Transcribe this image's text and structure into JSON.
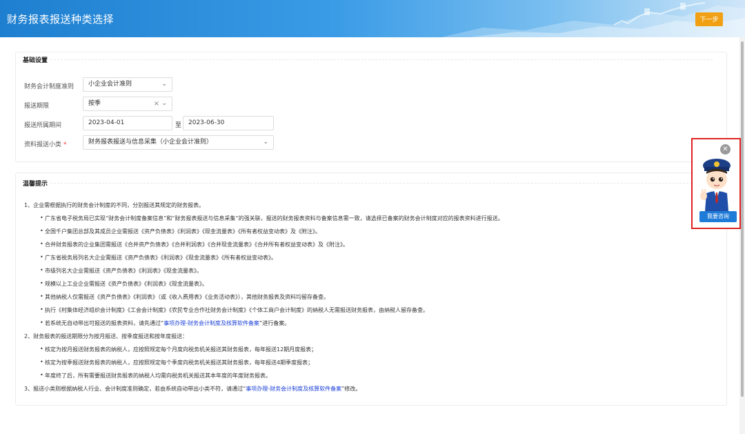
{
  "header": {
    "title": "财务报表报送种类选择",
    "next_label": "下一步"
  },
  "basic": {
    "section_title": "基础设置",
    "accounting_standard_label": "财务会计制度准则",
    "accounting_standard_value": "小企业会计准则",
    "period_label": "报送期限",
    "period_value": "按季",
    "date_label": "报送所属期间",
    "date_start": "2023-04-01",
    "date_sep": "至",
    "date_end": "2023-06-30",
    "subclass_label": "资料报送小类",
    "required_mark": "*",
    "subclass_value": "财务报表报送与信息采集（小企业会计准则）"
  },
  "tips": {
    "section_title": "温馨提示",
    "p1": "1、企业需根据执行的财务会计制度的不同，分别报送其规定的财务报表。",
    "b1": "广东省电子税务局已实现“财务会计制度备案信息”和“财务报表报送与信息采集”的强关联，报送的财务报表资料与备案信息需一致，请选择已备案的财务会计制度对应的报表资料进行报送。",
    "b2": "全国千户集团总部及其成员企业需报送《资产负债表》《利润表》《现金流量表》《所有者权益变动表》及《附注》。",
    "b3": "合并财务报表的企业集团需报送《合并资产负债表》《合并利润表》《合并现金流量表》《合并所有者权益变动表》及《附注》。",
    "b4": "广东省税务局列名大企业需报送《资产负债表》《利润表》《现金流量表》《所有者权益变动表》。",
    "b5": "市级列名大企业需报送《资产负债表》《利润表》《现金流量表》。",
    "b6": "规模以上工业企业需报送《资产负债表》《利润表》《现金流量表》。",
    "b7": "其他纳税人仅需报送《资产负债表》《利润表》（或《收入费用表》《业务活动表》），其他财务报表及资料均留存备查。",
    "b8": "执行《村集体经济组织会计制度》《工会会计制度》《农民专业合作社财务会计制度》《个体工商户会计制度》的纳税人无需报送财务报表，由纳税人留存备查。",
    "b9_pre": "若系统无自动带出可报送的报表资料，请先通过“",
    "b9_link": "事项办理-财务会计制度及核算软件备案",
    "b9_post": "”进行备案。",
    "p2": "2、财务报表的报送期限分为按月报送、按季度报送和按年度报送：",
    "b10": "核定为按月报送财务报表的纳税人，应按照规定每个月度向税务机关报送其财务报表，每年报送12期月度报表；",
    "b11": "核定为按季报送财务报表的纳税人，应按照规定每个季度向税务机关报送其财务报表，每年报送4期季度报表；",
    "b12": "年度终了后，所有需要报送财务报表的纳税人均需向税务机关报送其本年度的年度财务报表。",
    "p3_pre": "3、报送小类则根据纳税人行业、会计制度准则确定，若由系统自动带出小类不符，请通过“",
    "p3_link": "事项办理-财务会计制度及核算软件备案",
    "p3_post": "”修改。"
  },
  "assistant": {
    "close_glyph": "✕",
    "consult_label": "我要咨询"
  },
  "colors": {
    "header_blue": "#1e7fd0",
    "next_orange": "#f0a012",
    "link_blue": "#1b3fd6",
    "highlight_red": "#e02020"
  }
}
